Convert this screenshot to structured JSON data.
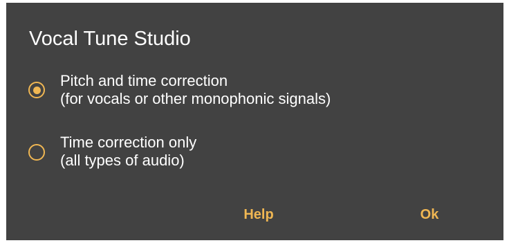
{
  "dialog": {
    "title": "Vocal Tune Studio",
    "options": [
      {
        "line1": "Pitch and time correction",
        "line2": "(for vocals or other monophonic signals)",
        "selected": true
      },
      {
        "line1": "Time correction only",
        "line2": "(all types of audio)",
        "selected": false
      }
    ],
    "buttons": {
      "help": "Help",
      "ok": "Ok"
    }
  },
  "colors": {
    "dialog_background": "#424242",
    "accent": "#f0b753",
    "text": "#ffffff"
  }
}
